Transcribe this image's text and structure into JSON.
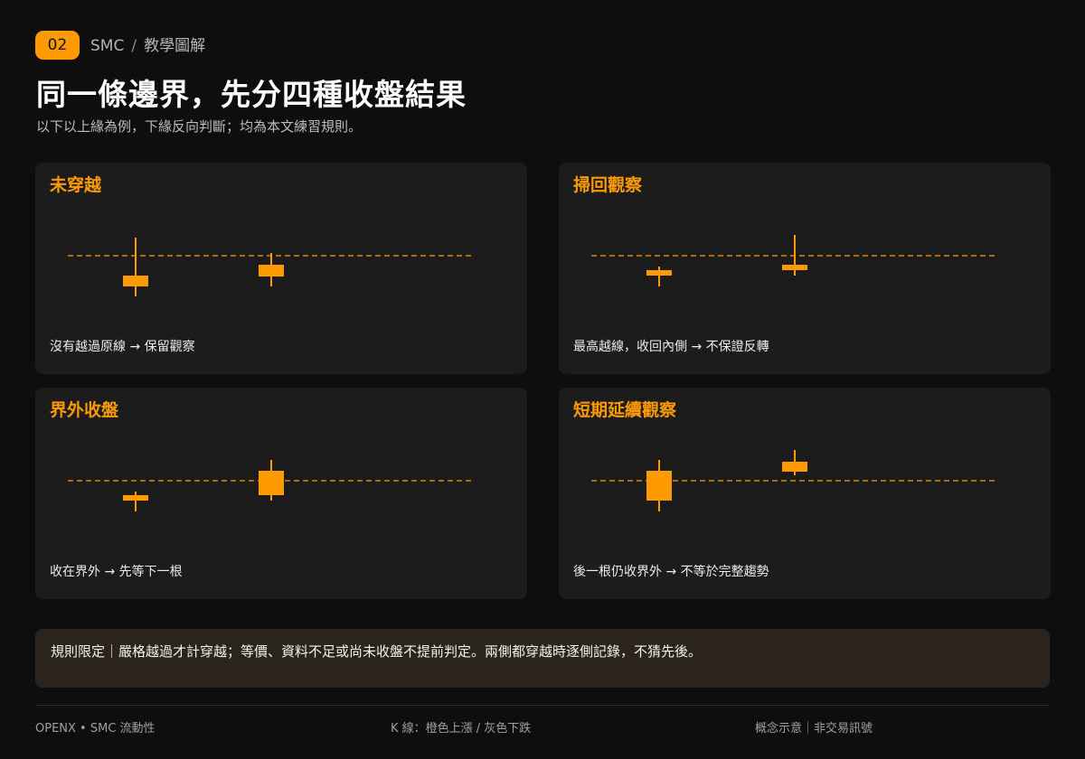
{
  "header": {
    "badge": "02",
    "breadcrumb": [
      "SMC",
      "教學圖解"
    ],
    "breadcrumb_sep": "/",
    "title": "同一條邊界，先分四種收盤結果",
    "subtitle": "以下以上緣為例，下緣反向判斷；均為本文練習規則。"
  },
  "colors": {
    "accent": "#ff9a00",
    "card_bg": "#1c1c1c",
    "note_bg": "#2a241b"
  },
  "cards": [
    {
      "title": "未穿越",
      "caption": "沒有越過原線 → 保留觀察",
      "candles": [
        {
          "high": -2.0,
          "low": 4.5,
          "open": 2.2,
          "close": 3.4
        },
        {
          "high": -0.3,
          "low": 3.4,
          "open": 1.0,
          "close": 2.3
        }
      ]
    },
    {
      "title": "掃回觀察",
      "caption": "最高越線，收回內側 → 不保證反轉",
      "candles": [
        {
          "high": 1.2,
          "low": 3.4,
          "open": 1.6,
          "close": 2.2
        },
        {
          "high": -2.3,
          "low": 2.2,
          "open": 1.0,
          "close": 1.6
        }
      ]
    },
    {
      "title": "界外收盤",
      "caption": "收在界外 → 先等下一根",
      "candles": [
        {
          "high": 1.2,
          "low": 3.4,
          "open": 1.6,
          "close": 2.2
        },
        {
          "high": -2.3,
          "low": 2.2,
          "open": -1.1,
          "close": 1.6
        }
      ]
    },
    {
      "title": "短期延續觀察",
      "caption": "後一根仍收界外 → 不等於完整趨勢",
      "candles": [
        {
          "high": -2.3,
          "low": 3.4,
          "open": -1.1,
          "close": 2.2
        },
        {
          "high": -3.4,
          "low": -0.6,
          "open": -2.1,
          "close": -1.0
        }
      ]
    }
  ],
  "note": {
    "text": "規則限定｜嚴格越過才計穿越；等價、資料不足或尚未收盤不提前判定。兩側都穿越時逐側記錄，不猜先後。"
  },
  "footer": {
    "left": "OPENX • SMC 流動性",
    "center": "K 線：橙色上漲 / 灰色下跌",
    "right": "概念示意｜非交易訊號"
  }
}
